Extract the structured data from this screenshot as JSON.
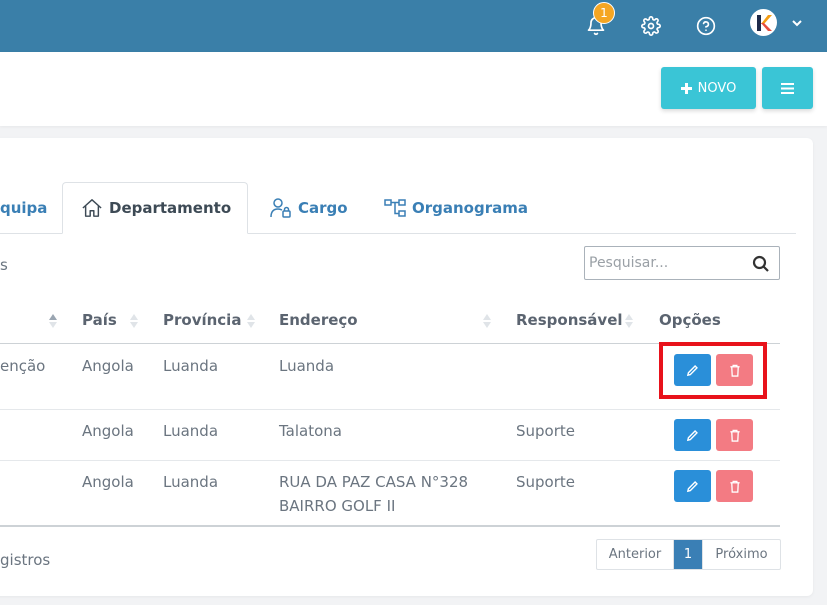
{
  "topbar": {
    "notification_count": "1",
    "icons": [
      "bell-icon",
      "gear-icon",
      "help-icon",
      "chevron-down-icon"
    ],
    "color": "#3a7fa8"
  },
  "actions": {
    "novo_label": "NOVO",
    "accent": "#3ac5d6"
  },
  "tabs": [
    {
      "label": "quipa",
      "icon": "users-icon"
    },
    {
      "label": "Departamento",
      "icon": "home-icon"
    },
    {
      "label": "Cargo",
      "icon": "user-lock-icon"
    },
    {
      "label": "Organograma",
      "icon": "org-chart-icon"
    }
  ],
  "active_tab": "Departamento",
  "list": {
    "length_text": "s",
    "search_placeholder": "Pesquisar..."
  },
  "table": {
    "columns": [
      "País",
      "Província",
      "Endereço",
      "Responsável",
      "Opções"
    ],
    "rows": [
      {
        "col0": "enção",
        "pais": "Angola",
        "provincia": "Luanda",
        "endereco": "Luanda",
        "endereco2": "",
        "responsavel": ""
      },
      {
        "col0": "",
        "pais": "Angola",
        "provincia": "Luanda",
        "endereco": "Talatona",
        "endereco2": "",
        "responsavel": "Suporte"
      },
      {
        "col0": "",
        "pais": "Angola",
        "provincia": "Luanda",
        "endereco": "RUA DA PAZ CASA N°328",
        "endereco2": "BAIRRO GOLF II",
        "responsavel": "Suporte"
      }
    ]
  },
  "footer": {
    "info": "gistros",
    "prev": "Anterior",
    "page": "1",
    "next": "Próximo"
  },
  "colors": {
    "edit": "#2a8fd9",
    "delete": "#f37b83",
    "highlight": "#e8121b",
    "link": "#3a7fb5"
  }
}
